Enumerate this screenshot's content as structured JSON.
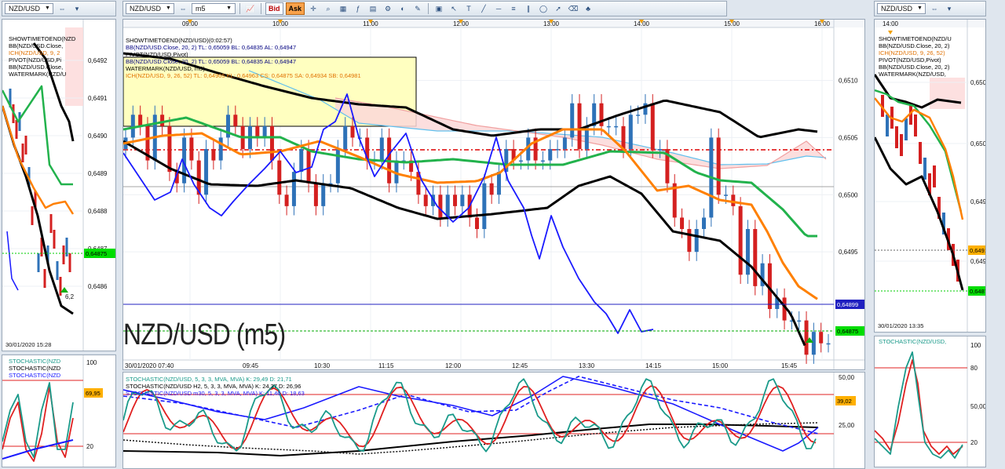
{
  "toolbars": {
    "left": {
      "symbol": "NZD/USD"
    },
    "main": {
      "symbol": "NZD/USD",
      "timeframe": "m5",
      "bid_label": "Bid",
      "ask_label": "Ask"
    },
    "right": {
      "symbol": "NZD/USD"
    }
  },
  "colors": {
    "up": "#2e72b8",
    "down": "#d42020",
    "bb": "#000000",
    "tenkan": "#ff8000",
    "kijun": "#22b24c",
    "chikou": "#1a1aff",
    "ssa": "#f0a0a0",
    "ssb": "#60c0ee",
    "cloud": "#fcd8d8",
    "watermark_box": "#ffffc0",
    "stoch_k": "#1a9a8a",
    "stoch_d": "#e02020",
    "stoch_h2": "#1a1aff",
    "ma": "#000000",
    "level_80": "#e02020",
    "level_20": "#e02020",
    "price_marker": "#00dd00",
    "value_tag": "#ffb000"
  },
  "legend_main": [
    {
      "text": "SHOWTIMETOEND(NZD/USD)(0:02:57)",
      "color": "#000000"
    },
    {
      "text": "BB(NZD/USD.Close, 20, 2)  TL: 0,65059  BL: 0,64835  AL: 0,64947",
      "color": "#000080"
    },
    {
      "text": "PIVOT(NZD/USD,Pivot)",
      "color": "#000000"
    },
    {
      "text": "BB(NZD/USD.Close, 20, 2)  TL: 0,65059  BL: 0,64835  AL: 0,64947",
      "color": "#000080"
    },
    {
      "text": "WATERMARK(NZD/USD, m5)",
      "color": "#000000"
    },
    {
      "text": "ICH(NZD/USD, 9, 26, 52)  TL: 0,64905  KL: 0,64963  CS: 0,64875  SA: 0,64934  SB: 0,64981",
      "color": "#e07000"
    }
  ],
  "legend_left": [
    {
      "text": "SHOWTIMETOEND(NZD",
      "color": "#000000"
    },
    {
      "text": "BB(NZD/USD.Close,",
      "color": "#000000"
    },
    {
      "text": "ICH(NZD/USD, 9, 2",
      "color": "#e07000"
    },
    {
      "text": "PIVOT(NZD/USD,Pi",
      "color": "#000000"
    },
    {
      "text": "BB(NZD/USD.Close,",
      "color": "#000000"
    },
    {
      "text": "WATERMARK(NZD/U",
      "color": "#000000"
    }
  ],
  "legend_right": [
    {
      "text": "SHOWTIMETOEND(NZD/U",
      "color": "#000000"
    },
    {
      "text": "BB(NZD/USD.Close, 20, 2)",
      "color": "#000000"
    },
    {
      "text": "ICH(NZD/USD, 9, 26, 52)",
      "color": "#e07000"
    },
    {
      "text": "PIVOT(NZD/USD,Pivot)",
      "color": "#000000"
    },
    {
      "text": "BB(NZD/USD.Close, 20, 2)",
      "color": "#000000"
    },
    {
      "text": "WATERMARK(NZD/USD,",
      "color": "#000000"
    }
  ],
  "stoch_legend_main": [
    {
      "text": "STOCHASTIC(NZD/USD, 5, 3, 3, MVA, MVA)  K: 29,49  D: 21,71",
      "color": "#1a9a8a"
    },
    {
      "text": "STOCHASTIC(NZD/USD H2, 5, 3, 3, MVA, MVA)  K: 24,37  D: 26,96",
      "color": "#000000"
    },
    {
      "text": "STOCHASTIC(NZD/USD m30, 5, 3, 3, MVA, MVA)  K: 11,46  D: 18,63",
      "color": "#1a1aff"
    }
  ],
  "stoch_legend_left": [
    {
      "text": "STOCHASTIC(NZD",
      "color": "#1a9a8a"
    },
    {
      "text": "STOCHASTIC(NZD",
      "color": "#000000"
    },
    {
      "text": "STOCHASTIC(NZD",
      "color": "#1a1aff"
    }
  ],
  "stoch_legend_right": [
    {
      "text": "STOCHASTIC(NZD/USD,",
      "color": "#1a9a8a"
    }
  ],
  "left_chart": {
    "y_labels": [
      "0,6492",
      "0,6491",
      "0,6490",
      "0,6489",
      "0,6488",
      "0,6487",
      "0,6486"
    ],
    "price_tag": "0,64875",
    "timestamp": "30/01/2020 15:28",
    "stoch_labels": [
      "100",
      "69,95",
      "20"
    ],
    "marker_text": "6,2"
  },
  "right_chart": {
    "top_time_label": "14:00",
    "y_labels": [
      "0,6505",
      "0,6500",
      "0,6495",
      "0,6490"
    ],
    "price_tag": "0,64875",
    "value_tag": "0,64910",
    "timestamp": "30/01/2020 13:35",
    "stoch_labels": [
      "100",
      "80",
      "50,00",
      "20"
    ]
  },
  "chart_data": {
    "type": "candlestick",
    "title": "NZD/USD (m5)",
    "symbol": "NZD/USD",
    "timeframe": "m5",
    "top_time_axis": [
      "09:00",
      "10:00",
      "11:00",
      "12:00",
      "13:00",
      "14:00",
      "15:00",
      "16:00"
    ],
    "bottom_time_axis": [
      "30/01/2020 07:40",
      "09:45",
      "10:30",
      "11:15",
      "12:00",
      "12:45",
      "13:30",
      "14:15",
      "15:00",
      "15:45"
    ],
    "y_axis_labels": [
      "0,6510",
      "0,6505",
      "0,6500",
      "0,6495"
    ],
    "ylim": [
      0.64865,
      0.65145
    ],
    "price_tags": {
      "current": "0,64875",
      "line": "0,64899"
    },
    "open": [
      0.6504,
      0.6505,
      0.6507,
      0.6506,
      0.6503,
      0.6507,
      0.6506,
      0.6502,
      0.6501,
      0.6505,
      0.6503,
      0.65,
      0.6504,
      0.6503,
      0.6505,
      0.6507,
      0.6506,
      0.6504,
      0.6506,
      0.6505,
      0.6506,
      0.6503,
      0.65,
      0.6499,
      0.6502,
      0.6504,
      0.6501,
      0.6499,
      0.6501,
      0.6501,
      0.6504,
      0.6506,
      0.6505,
      0.6505,
      0.6503,
      0.6503,
      0.6505,
      0.6501,
      0.6503,
      0.6503,
      0.6502,
      0.65,
      0.6499,
      0.65,
      0.6498,
      0.65,
      0.6499,
      0.65,
      0.6498,
      0.6497,
      0.6501,
      0.65,
      0.6502,
      0.6504,
      0.6503,
      0.6503,
      0.6505,
      0.6503,
      0.6503,
      0.6504,
      0.6504,
      0.6505,
      0.6508,
      0.6504,
      0.6506,
      0.6508,
      0.6506,
      0.6506,
      0.6506,
      0.6504,
      0.6507,
      0.6507,
      0.6508,
      0.6504,
      0.6504,
      0.6501,
      0.6498,
      0.6497,
      0.6495,
      0.6497,
      0.6498,
      0.6505,
      0.65,
      0.65,
      0.6499,
      0.6493,
      0.6497,
      0.6492,
      0.6494,
      0.649,
      0.6491,
      0.6489,
      0.6489,
      0.6489,
      0.6486,
      0.6488,
      0.6487
    ],
    "close": [
      0.6505,
      0.6507,
      0.6506,
      0.6503,
      0.6507,
      0.6506,
      0.6502,
      0.6501,
      0.6505,
      0.6503,
      0.65,
      0.6504,
      0.6503,
      0.6505,
      0.6507,
      0.6506,
      0.6504,
      0.6506,
      0.6505,
      0.6506,
      0.6503,
      0.65,
      0.6499,
      0.6502,
      0.6504,
      0.6501,
      0.6499,
      0.6501,
      0.6501,
      0.6504,
      0.6506,
      0.6505,
      0.6505,
      0.6503,
      0.6503,
      0.6505,
      0.6501,
      0.6503,
      0.6503,
      0.6502,
      0.65,
      0.6499,
      0.65,
      0.6498,
      0.65,
      0.6499,
      0.65,
      0.6498,
      0.6497,
      0.6501,
      0.65,
      0.6502,
      0.6504,
      0.6503,
      0.6503,
      0.6505,
      0.6503,
      0.6503,
      0.6504,
      0.6504,
      0.6505,
      0.6508,
      0.6504,
      0.6506,
      0.6508,
      0.6506,
      0.6506,
      0.6506,
      0.6504,
      0.6507,
      0.6507,
      0.6508,
      0.6504,
      0.6504,
      0.6501,
      0.6498,
      0.6497,
      0.6495,
      0.6497,
      0.6498,
      0.6505,
      0.65,
      0.65,
      0.6499,
      0.6493,
      0.6497,
      0.6492,
      0.6494,
      0.649,
      0.6491,
      0.6489,
      0.6489,
      0.6489,
      0.6486,
      0.6488,
      0.6487,
      0.6487
    ],
    "stoch_axis_labels": [
      "50,00",
      "39,02",
      "25,00"
    ],
    "stoch_levels": [
      80,
      20
    ]
  }
}
